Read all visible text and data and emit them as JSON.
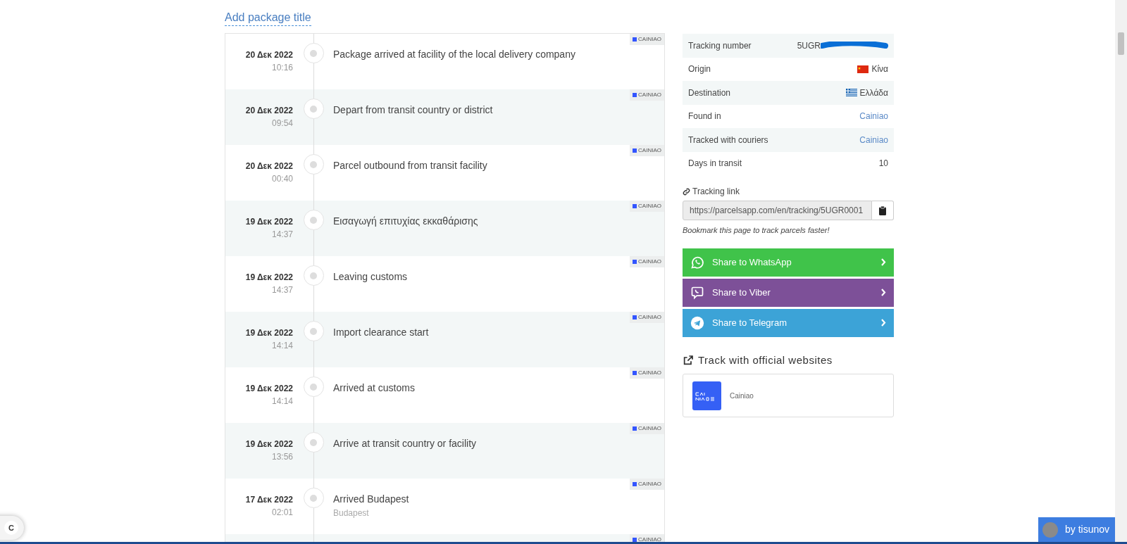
{
  "title_link": "Add package title",
  "events": [
    {
      "date": "20 Δεκ 2022",
      "time": "10:16",
      "status": "Package arrived at facility of the local delivery company",
      "badge": "CAINIAO"
    },
    {
      "date": "20 Δεκ 2022",
      "time": "09:54",
      "status": "Depart from transit country or district",
      "badge": "CAINIAO"
    },
    {
      "date": "20 Δεκ 2022",
      "time": "00:40",
      "status": "Parcel outbound from transit facility",
      "badge": "CAINIAO"
    },
    {
      "date": "19 Δεκ 2022",
      "time": "14:37",
      "status": "Εισαγωγή επιτυχίας εκκαθάρισης",
      "badge": "CAINIAO"
    },
    {
      "date": "19 Δεκ 2022",
      "time": "14:37",
      "status": "Leaving customs",
      "badge": "CAINIAO"
    },
    {
      "date": "19 Δεκ 2022",
      "time": "14:14",
      "status": "Import clearance start",
      "badge": "CAINIAO"
    },
    {
      "date": "19 Δεκ 2022",
      "time": "14:14",
      "status": "Arrived at customs",
      "badge": "CAINIAO"
    },
    {
      "date": "19 Δεκ 2022",
      "time": "13:56",
      "status": "Arrive at transit country or facility",
      "badge": "CAINIAO"
    },
    {
      "date": "17 Δεκ 2022",
      "time": "02:01",
      "status": "Arrived Budapest",
      "location": "Budapest",
      "badge": "CAINIAO"
    },
    {
      "badge": "CAINIAO"
    }
  ],
  "details": [
    {
      "label": "Tracking number",
      "value": "5UGR",
      "kind": "redacted"
    },
    {
      "label": "Origin",
      "value": "Κίνα",
      "kind": "china-flag"
    },
    {
      "label": "Destination",
      "value": "Ελλάδα",
      "kind": "greece-flag"
    },
    {
      "label": "Found in",
      "value": "Cainiao",
      "kind": "link"
    },
    {
      "label": "Tracked with couriers",
      "value": "Cainiao",
      "kind": "link"
    },
    {
      "label": "Days in transit",
      "value": "10",
      "kind": "text"
    }
  ],
  "tracking_link": {
    "label": "Tracking link",
    "value": "https://parcelsapp.com/en/tracking/5UGR0001",
    "note": "Bookmark this page to track parcels faster!"
  },
  "share_buttons": [
    {
      "label": "Share to WhatsApp",
      "kind": "whatsapp",
      "color": "#40c34a"
    },
    {
      "label": "Share to Viber",
      "kind": "viber",
      "color": "#7d5098"
    },
    {
      "label": "Share to Telegram",
      "kind": "telegram",
      "color": "#3ca3d7"
    }
  ],
  "official": {
    "heading": "Track with official websites",
    "carriers": [
      {
        "name": "Cainiao"
      }
    ]
  },
  "chat_button": {
    "label": "C"
  },
  "credit": {
    "label": "by tisunov"
  }
}
